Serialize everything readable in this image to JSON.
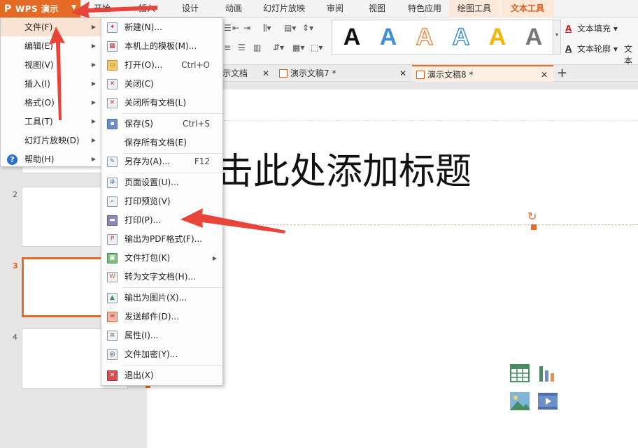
{
  "app": {
    "name": "WPS 演示",
    "logo": "P"
  },
  "tabs": [
    "开始",
    "插入",
    "设计",
    "动画",
    "幻灯片放映",
    "审阅",
    "视图",
    "特色应用",
    "绘图工具",
    "文本工具"
  ],
  "ribbon": {
    "text_fill": "文本填充",
    "text_outline": "文本轮廓",
    "text_extra": "文本",
    "style_letter": "A",
    "style_colors": [
      "#111111",
      "#3d8fd6",
      "#ef8d4a",
      "#3d8fd6",
      "#f2b600",
      "#777777"
    ]
  },
  "doc_tabs": [
    {
      "label": "示文档"
    },
    {
      "label": "演示文稿7 *"
    },
    {
      "label": "演示文稿8 *"
    }
  ],
  "main_menu": [
    {
      "label": "文件(F)"
    },
    {
      "label": "编辑(E)"
    },
    {
      "label": "视图(V)"
    },
    {
      "label": "插入(I)"
    },
    {
      "label": "格式(O)"
    },
    {
      "label": "工具(T)"
    },
    {
      "label": "幻灯片放映(D)"
    },
    {
      "label": "帮助(H)"
    }
  ],
  "file_menu": [
    {
      "label": "新建(N)...",
      "shortcut": "",
      "icon": "new-file-icon"
    },
    {
      "label": "本机上的模板(M)...",
      "shortcut": "",
      "icon": "template-icon"
    },
    {
      "label": "打开(O)...",
      "shortcut": "Ctrl+O",
      "icon": "open-folder-icon"
    },
    {
      "label": "关闭(C)",
      "shortcut": "",
      "icon": "close-doc-icon"
    },
    {
      "label": "关闭所有文档(L)",
      "shortcut": "",
      "icon": "close-all-icon"
    },
    {
      "label": "保存(S)",
      "shortcut": "Ctrl+S",
      "icon": "save-icon"
    },
    {
      "label": "保存所有文档(E)",
      "shortcut": "",
      "icon": ""
    },
    {
      "label": "另存为(A)...",
      "shortcut": "F12",
      "icon": "save-as-icon"
    },
    {
      "label": "页面设置(U)...",
      "shortcut": "",
      "icon": "page-setup-icon"
    },
    {
      "label": "打印预览(V)",
      "shortcut": "",
      "icon": "print-preview-icon"
    },
    {
      "label": "打印(P)...",
      "shortcut": "",
      "icon": "printer-icon"
    },
    {
      "label": "输出为PDF格式(F)...",
      "shortcut": "",
      "icon": "pdf-icon"
    },
    {
      "label": "文件打包(K)",
      "shortcut": "",
      "icon": "package-icon"
    },
    {
      "label": "转为文字文档(H)...",
      "shortcut": "",
      "icon": "convert-text-icon"
    },
    {
      "label": "输出为图片(X)...",
      "shortcut": "",
      "icon": "export-image-icon"
    },
    {
      "label": "发送邮件(D)...",
      "shortcut": "",
      "icon": "mail-icon"
    },
    {
      "label": "属性(I)...",
      "shortcut": "",
      "icon": "properties-icon"
    },
    {
      "label": "文件加密(Y)...",
      "shortcut": "",
      "icon": "encrypt-icon"
    },
    {
      "label": "退出(X)",
      "shortcut": "",
      "icon": "exit-icon"
    }
  ],
  "slides": [
    {
      "num": "2"
    },
    {
      "num": "3"
    },
    {
      "num": "4"
    }
  ],
  "slide": {
    "title_placeholder": "击此处添加标题"
  },
  "colors": {
    "accent": "#e56a26",
    "annotation": "#e8443a"
  }
}
